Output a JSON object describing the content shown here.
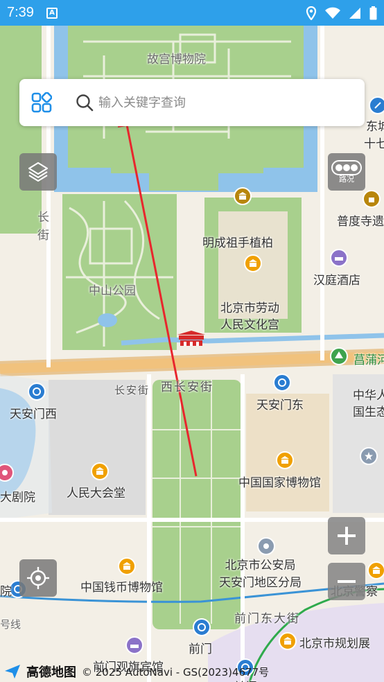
{
  "status_bar": {
    "time": "7:39",
    "notification_icon": "A"
  },
  "search": {
    "placeholder": "输入关键字查询"
  },
  "controls": {
    "traffic_label": "路况"
  },
  "map_labels": {
    "gugong": "故宫博物院",
    "dongshi": "东城区",
    "shiqi": "十七",
    "chang": "长",
    "jie": "街",
    "pudusi": "普度寺遗",
    "mingchengzu": "明成祖手植柏",
    "zhongshan": "中山公园",
    "hanting": "汉庭酒店",
    "laodong": "北京市劳动\n人民文化宫",
    "changpu": "菖蒲河",
    "changanjie": "长安街",
    "xichangan": "西长安街",
    "tiananmenxi": "天安门西",
    "tiananmendong": "天安门东",
    "zhonghua": "中华人\n国生态",
    "dajuyuan": "大剧院",
    "renmindahuitang": "人民大会堂",
    "guojiabowuguan": "中国国家博物馆",
    "gonganju": "北京市公安局\n天安门地区分局",
    "qianbi": "中国钱币博物馆",
    "jingcha": "北京警察",
    "yuan": "院",
    "haoxian": "号线",
    "qianmendongdajie": "前门东大街",
    "qianmen1": "前门",
    "guihua": "北京市规划展",
    "qianmenguanqi": "前门观旗宾馆",
    "qianmen2": "前门"
  },
  "footer": {
    "logo": "高德地图",
    "copyright": "© 2025 AutoNavi - GS(2023)4677号"
  },
  "colors": {
    "status_bar": "#2ea0ea",
    "green": "#a8d08d",
    "water": "#8fc3ea",
    "road": "#f1c27d",
    "poi": "#f0a000",
    "arrow": "#e8262d"
  }
}
